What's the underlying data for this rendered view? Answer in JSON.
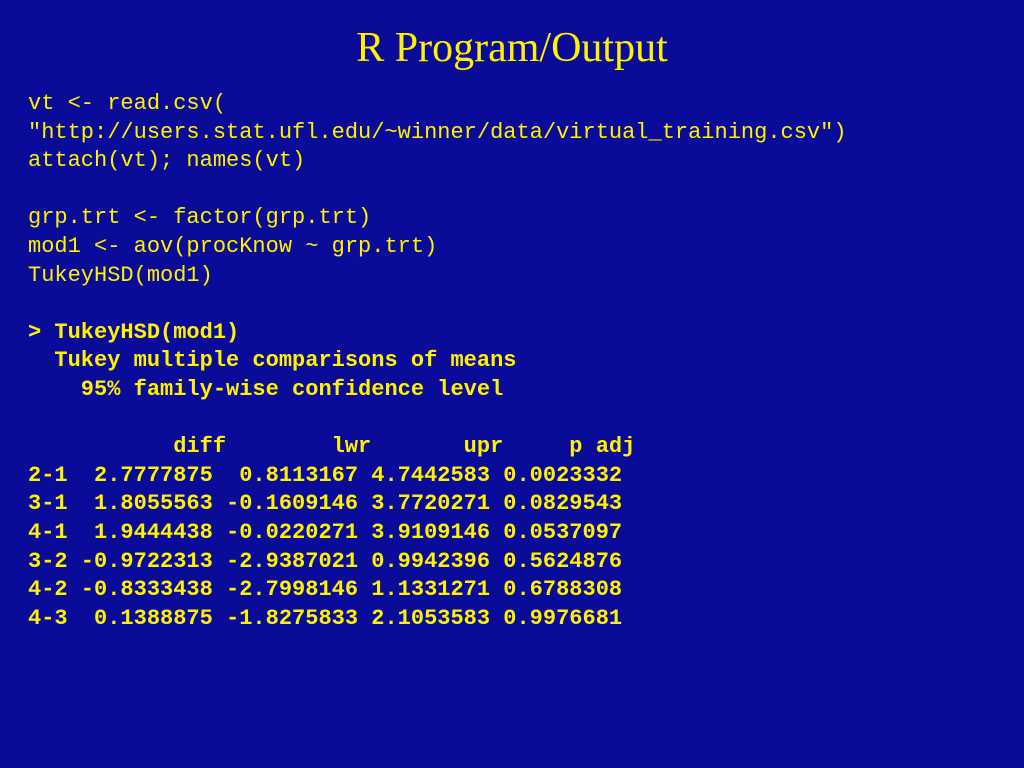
{
  "title": "R Program/Output",
  "code": {
    "l1": "vt <- read.csv(",
    "l2": "\"http://users.stat.ufl.edu/~winner/data/virtual_training.csv\")",
    "l3": "attach(vt); names(vt)",
    "l4": "",
    "l5": "grp.trt <- factor(grp.trt)",
    "l6": "mod1 <- aov(procKnow ~ grp.trt)",
    "l7": "TukeyHSD(mod1)",
    "l8": "",
    "l9": "> TukeyHSD(mod1)",
    "l10": "  Tukey multiple comparisons of means",
    "l11": "    95% family-wise confidence level",
    "l12": "",
    "l13": "           diff        lwr       upr     p adj",
    "l14": "2-1  2.7777875  0.8113167 4.7442583 0.0023332",
    "l15": "3-1  1.8055563 -0.1609146 3.7720271 0.0829543",
    "l16": "4-1  1.9444438 -0.0220271 3.9109146 0.0537097",
    "l17": "3-2 -0.9722313 -2.9387021 0.9942396 0.5624876",
    "l18": "4-2 -0.8333438 -2.7998146 1.1331271 0.6788308",
    "l19": "4-3  0.1388875 -1.8275833 2.1053583 0.9976681"
  }
}
